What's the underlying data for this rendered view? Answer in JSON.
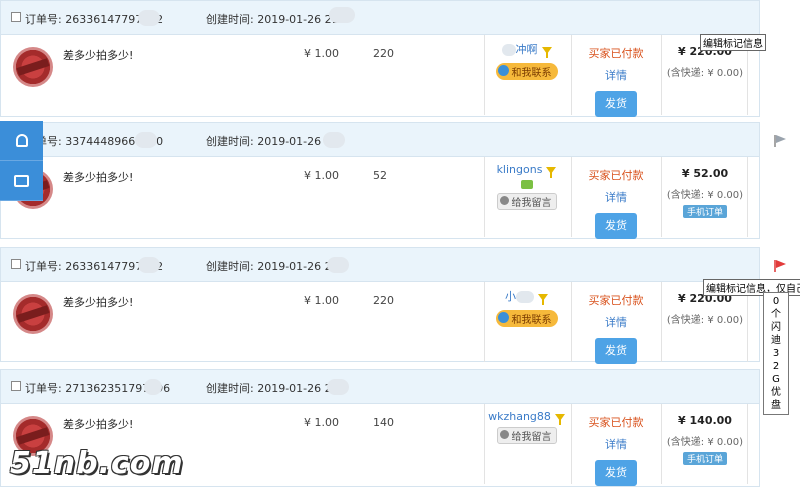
{
  "labels": {
    "order_no_prefix": "订单号: ",
    "created_prefix": "创建时间: ",
    "details": "详情",
    "ship": "发货",
    "shipping_included": "(含快递: ¥ 0.00)",
    "contact_me": "和我联系",
    "leave_msg": "给我留言",
    "mobile_order": "手机订单"
  },
  "orders": [
    {
      "order_no": "26336147797452",
      "created": "2019-01-26 21:",
      "title": "差多少拍多少!",
      "unit_price": "¥ 1.00",
      "qty": "220",
      "buyer": "冲啊",
      "status": "买家已付款",
      "amount": "¥ 220.00"
    },
    {
      "order_no": "33744489668380",
      "created": "2019-01-26 21:",
      "title": "差多少拍多少!",
      "unit_price": "¥ 1.00",
      "qty": "52",
      "buyer": "klingons",
      "status": "买家已付款",
      "amount": "¥ 52.00"
    },
    {
      "order_no": "26336147797452",
      "created": "2019-01-26 21:",
      "title": "差多少拍多少!",
      "unit_price": "¥ 1.00",
      "qty": "220",
      "buyer": "小",
      "status": "买家已付款",
      "amount": "¥ 220.00"
    },
    {
      "order_no": "271362351797596",
      "created": "2019-01-26 21:",
      "title": "差多少拍多少!",
      "unit_price": "¥ 1.00",
      "qty": "140",
      "buyer": "wkzhang88",
      "status": "买家已付款",
      "amount": "¥ 140.00"
    }
  ],
  "tooltips": {
    "edit_mark": "编辑标记信息",
    "edit_mark_only": "编辑标记信息，仅自己",
    "vertical_note": [
      "0",
      "个",
      "闪",
      "迪",
      "3",
      "2",
      "G",
      "优",
      "盘"
    ]
  },
  "watermark": "51nb.com",
  "colors": {
    "accent": "#4ea3e6",
    "status": "#d9531e",
    "header_bg": "#eaf4fb"
  }
}
